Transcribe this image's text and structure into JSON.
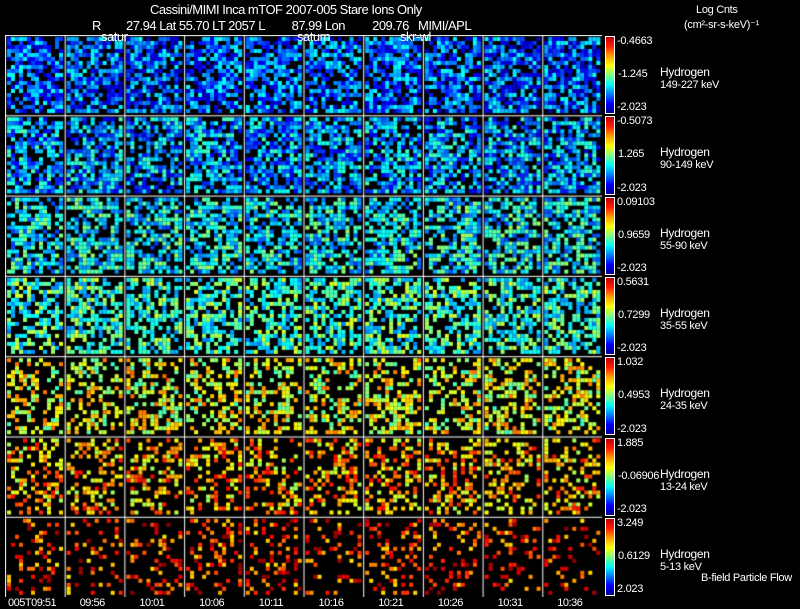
{
  "header": {
    "title": "Cassini/MIMI Inca mTOF  2007-005   Stare   Ions Only",
    "r_label": "R",
    "r_value": "27.94",
    "lat_label": "Lat",
    "lat_value": "55.70",
    "lt_label": "LT",
    "lt_value": "2057",
    "l_label": "L",
    "l_value": "87.99",
    "lon_label": "Lon",
    "lon_value": "209.76",
    "credit": "MIMI/APL",
    "units_line1": "Log Cnts",
    "units_line2": "(cm²-sr-s-keV)⁻¹"
  },
  "overlays": [
    "satur",
    "saturn",
    "skr-wl"
  ],
  "legend_note": "B-field Particle Flow",
  "chart_data": {
    "type": "heatmap",
    "times": [
      "005T09:51",
      "09:56",
      "10:01",
      "10:06",
      "10:11",
      "10:16",
      "10:21",
      "10:26",
      "10:31",
      "10:36"
    ],
    "panels": [
      {
        "species": "Hydrogen",
        "energy": "149-227 keV",
        "max": "-0.4663",
        "mid": "-1.245",
        "min": "-2.023"
      },
      {
        "species": "Hydrogen",
        "energy": "90-149 keV",
        "max": "-0.5073",
        "mid": "1.265",
        "min": "-2.023"
      },
      {
        "species": "Hydrogen",
        "energy": "55-90 keV",
        "max": "0.09103",
        "mid": "0.9659",
        "min": "-2.023"
      },
      {
        "species": "Hydrogen",
        "energy": "35-55 keV",
        "max": "0.5631",
        "mid": "0.7299",
        "min": "-2.023"
      },
      {
        "species": "Hydrogen",
        "energy": "24-35 keV",
        "max": "1.032",
        "mid": "0.4953",
        "min": "-2.023"
      },
      {
        "species": "Hydrogen",
        "energy": "13-24 keV",
        "max": "1.885",
        "mid": "-0.06906",
        "min": "-2.023"
      },
      {
        "species": "Hydrogen",
        "energy": "5-13 keV",
        "max": "3.249",
        "mid": "0.6129",
        "min": "2.023"
      }
    ],
    "colormap": [
      "#00008f",
      "#0000ff",
      "#00ffff",
      "#ffff00",
      "#ff8000",
      "#c00000"
    ]
  }
}
